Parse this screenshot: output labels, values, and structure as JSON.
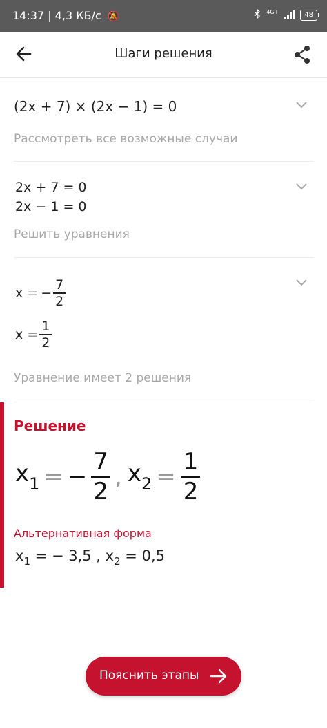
{
  "status_bar": {
    "time": "14:37",
    "speed": "| 4,3 КБ/с",
    "network": "4G+",
    "battery": "48"
  },
  "header": {
    "title": "Шаги решения"
  },
  "steps": [
    {
      "equation": [
        "(2x + 7) × (2x − 1) = 0"
      ],
      "description": "Рассмотреть все возможные случаи"
    },
    {
      "equations": [
        "2x + 7 = 0",
        "2x − 1 = 0"
      ],
      "description": "Решить уравнения"
    },
    {
      "x1": {
        "sign": "−",
        "num": "7",
        "den": "2"
      },
      "x2": {
        "num": "1",
        "den": "2"
      },
      "description": "Уравнение имеет 2 решения"
    }
  ],
  "solution": {
    "title": "Решение",
    "x1_sign": "−",
    "x1_num": "7",
    "x1_den": "2",
    "x2_num": "1",
    "x2_den": "2",
    "alt_title": "Альтернативная форма",
    "alt_x1": "− 3,5",
    "alt_x2": "0,5"
  },
  "explain_button": {
    "label": "Пояснить этапы"
  },
  "colors": {
    "accent": "#c4122f",
    "status_bar": "#5a5a5a"
  }
}
